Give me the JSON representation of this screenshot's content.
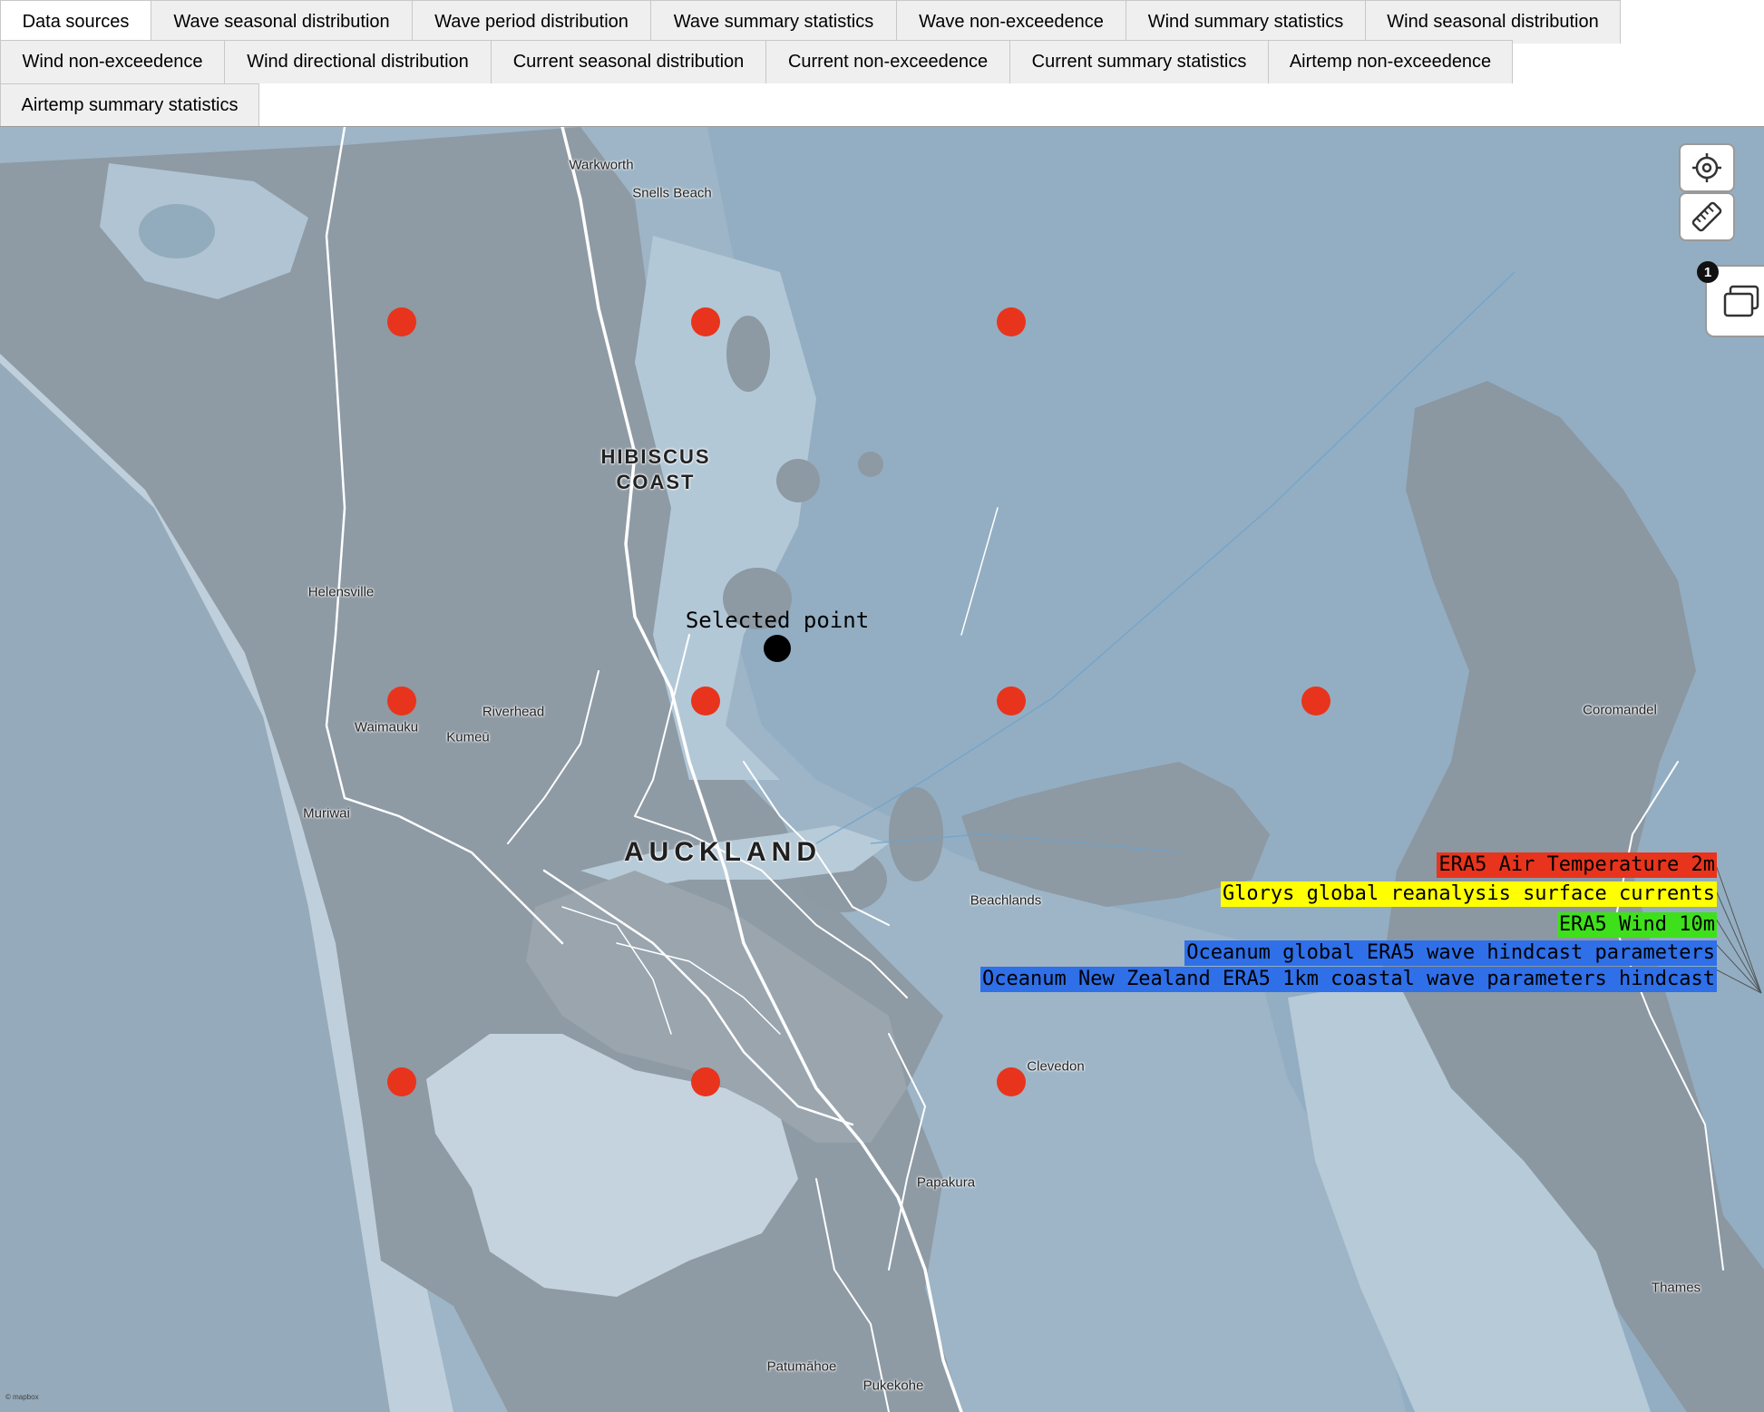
{
  "tabs": {
    "row1": [
      "Data sources",
      "Wave seasonal distribution",
      "Wave period distribution",
      "Wave summary statistics",
      "Wave non-exceedence",
      "Wind summary statistics",
      "Wind seasonal distribution"
    ],
    "row2": [
      "Wind non-exceedence",
      "Wind directional distribution",
      "Current seasonal distribution",
      "Current non-exceedence",
      "Current summary statistics",
      "Airtemp non-exceedence"
    ],
    "row3": [
      "Airtemp summary statistics"
    ],
    "active": "Data sources"
  },
  "map": {
    "places": {
      "warkworth": "Warkworth",
      "snells_beach": "Snells Beach",
      "hibiscus_coast_1": "HIBISCUS",
      "hibiscus_coast_2": "COAST",
      "helensville": "Helensville",
      "riverhead": "Riverhead",
      "waimauku": "Waimauku",
      "kumeu": "Kumeū",
      "muriwai": "Muriwai",
      "auckland": "AUCKLAND",
      "beachlands": "Beachlands",
      "coromandel": "Coromandel",
      "clevedon": "Clevedon",
      "papakura": "Papakura",
      "thames": "Thames",
      "patumahoe": "Patumāhoe",
      "pukekohe": "Pukekohe"
    },
    "selected_point_label": "Selected point",
    "attribution": "© mapbox"
  },
  "legend": {
    "items": [
      {
        "label": "ERA5 Air Temperature 2m",
        "color": "#e8341c"
      },
      {
        "label": "Glorys global reanalysis surface currents",
        "color": "#ffff00"
      },
      {
        "label": "ERA5 Wind 10m",
        "color": "#3ee01b"
      },
      {
        "label": "Oceanum global ERA5 wave hindcast parameters",
        "color": "#2f6fe8"
      },
      {
        "label": "Oceanum New Zealand ERA5 1km coastal wave parameters hindcast",
        "color": "#2f6fe8"
      }
    ]
  },
  "controls": {
    "locate_icon": "crosshair-icon",
    "measure_icon": "ruler-icon",
    "layers_icon": "layers-icon",
    "layers_badge": "1"
  }
}
